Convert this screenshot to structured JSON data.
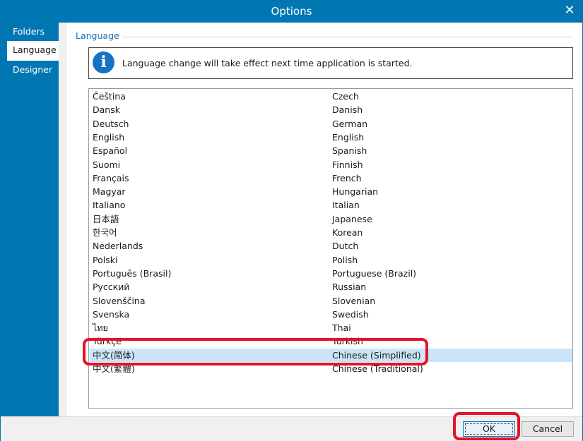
{
  "window": {
    "title": "Options",
    "close_icon": "close-icon"
  },
  "sidebar": {
    "items": [
      {
        "label": "Folders",
        "active": false
      },
      {
        "label": "Language",
        "active": true
      },
      {
        "label": "Designer",
        "active": false
      }
    ]
  },
  "language_panel": {
    "group_label": "Language",
    "info_icon": "info-icon",
    "info_message": "Language change will take effect next time application is started.",
    "selected_index": 19,
    "languages": [
      {
        "native": "Čeština",
        "english": "Czech"
      },
      {
        "native": "Dansk",
        "english": "Danish"
      },
      {
        "native": "Deutsch",
        "english": "German"
      },
      {
        "native": "English",
        "english": "English"
      },
      {
        "native": "Español",
        "english": "Spanish"
      },
      {
        "native": "Suomi",
        "english": "Finnish"
      },
      {
        "native": "Français",
        "english": "French"
      },
      {
        "native": "Magyar",
        "english": "Hungarian"
      },
      {
        "native": "Italiano",
        "english": "Italian"
      },
      {
        "native": "日本語",
        "english": "Japanese"
      },
      {
        "native": "한국어",
        "english": "Korean"
      },
      {
        "native": "Nederlands",
        "english": "Dutch"
      },
      {
        "native": "Polski",
        "english": "Polish"
      },
      {
        "native": "Português (Brasil)",
        "english": "Portuguese (Brazil)"
      },
      {
        "native": "Русский",
        "english": "Russian"
      },
      {
        "native": "Slovenščina",
        "english": "Slovenian"
      },
      {
        "native": "Svenska",
        "english": "Swedish"
      },
      {
        "native": "ไทย",
        "english": "Thai"
      },
      {
        "native": "Türkçe",
        "english": "Turkish"
      },
      {
        "native": "中文(简体)",
        "english": "Chinese (Simplified)"
      },
      {
        "native": "中文(繁體)",
        "english": "Chinese (Traditional)"
      }
    ]
  },
  "footer": {
    "ok_label": "OK",
    "cancel_label": "Cancel"
  },
  "annotation_color": "#e3132b"
}
